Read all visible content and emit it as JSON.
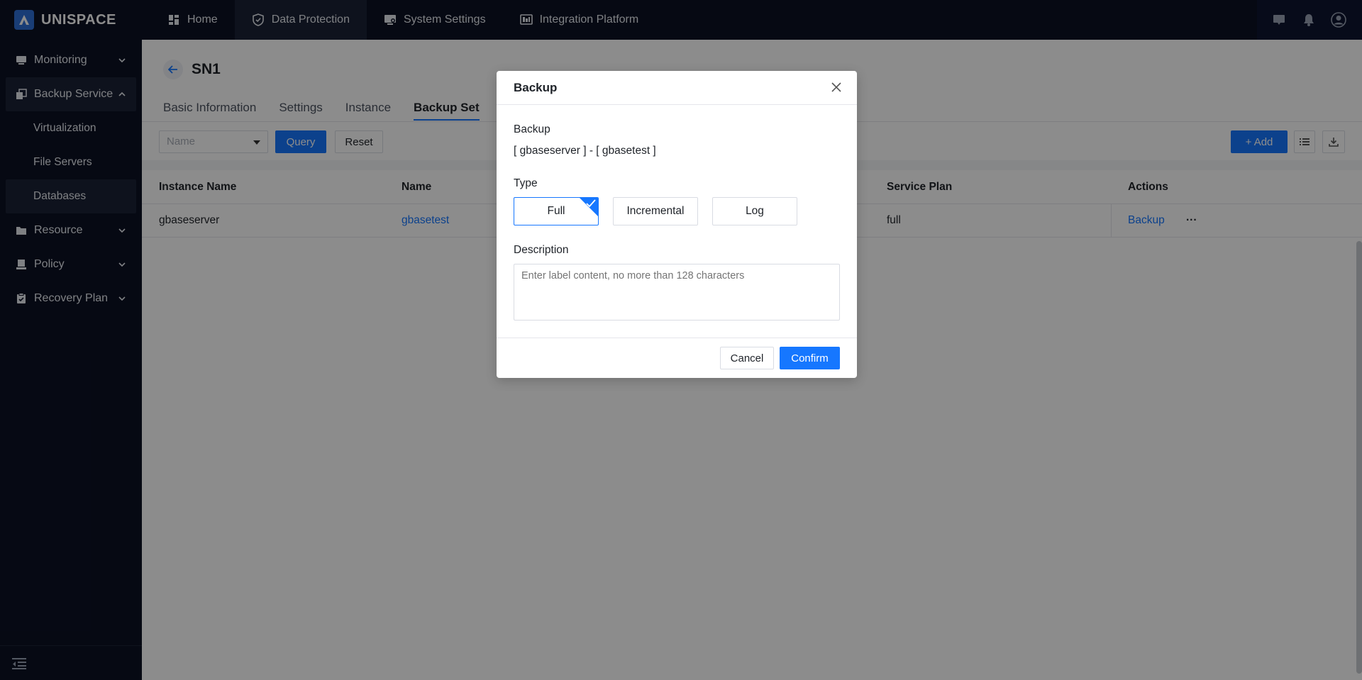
{
  "brand": {
    "name": "UNISPACE"
  },
  "top_nav": [
    {
      "label": "Home",
      "icon": "dashboard-icon"
    },
    {
      "label": "Data Protection",
      "icon": "shield-icon",
      "active": true
    },
    {
      "label": "System Settings",
      "icon": "settings-monitor-icon"
    },
    {
      "label": "Integration Platform",
      "icon": "integration-icon"
    }
  ],
  "sidebar": {
    "items": [
      {
        "label": "Monitoring"
      },
      {
        "label": "Backup Service"
      },
      {
        "label": "Resource"
      },
      {
        "label": "Policy"
      },
      {
        "label": "Recovery Plan"
      }
    ],
    "sub_items": [
      {
        "label": "Virtualization"
      },
      {
        "label": "File Servers"
      },
      {
        "label": "Databases"
      }
    ]
  },
  "page": {
    "title": "SN1",
    "tabs": [
      "Basic Information",
      "Settings",
      "Instance",
      "Backup Set"
    ]
  },
  "filter": {
    "name_placeholder": "Name",
    "query_label": "Query",
    "reset_label": "Reset",
    "add_label": "+ Add"
  },
  "table": {
    "columns": [
      "Instance Name",
      "Name",
      "Service Plan",
      "Actions"
    ],
    "rows": [
      {
        "instance_name": "gbaseserver",
        "name": "gbasetest",
        "service_plan": "full",
        "action": "Backup",
        "more": "···"
      }
    ]
  },
  "modal": {
    "title": "Backup",
    "backup_label": "Backup",
    "backup_value": "[ gbaseserver ] - [ gbasetest ]",
    "type_label": "Type",
    "types": [
      "Full",
      "Incremental",
      "Log"
    ],
    "selected_type": "Full",
    "description_label": "Description",
    "description_placeholder": "Enter label content, no more than 128 characters",
    "cancel_label": "Cancel",
    "confirm_label": "Confirm"
  },
  "colors": {
    "primary": "#1677ff",
    "nav_bg": "#0b1124"
  }
}
